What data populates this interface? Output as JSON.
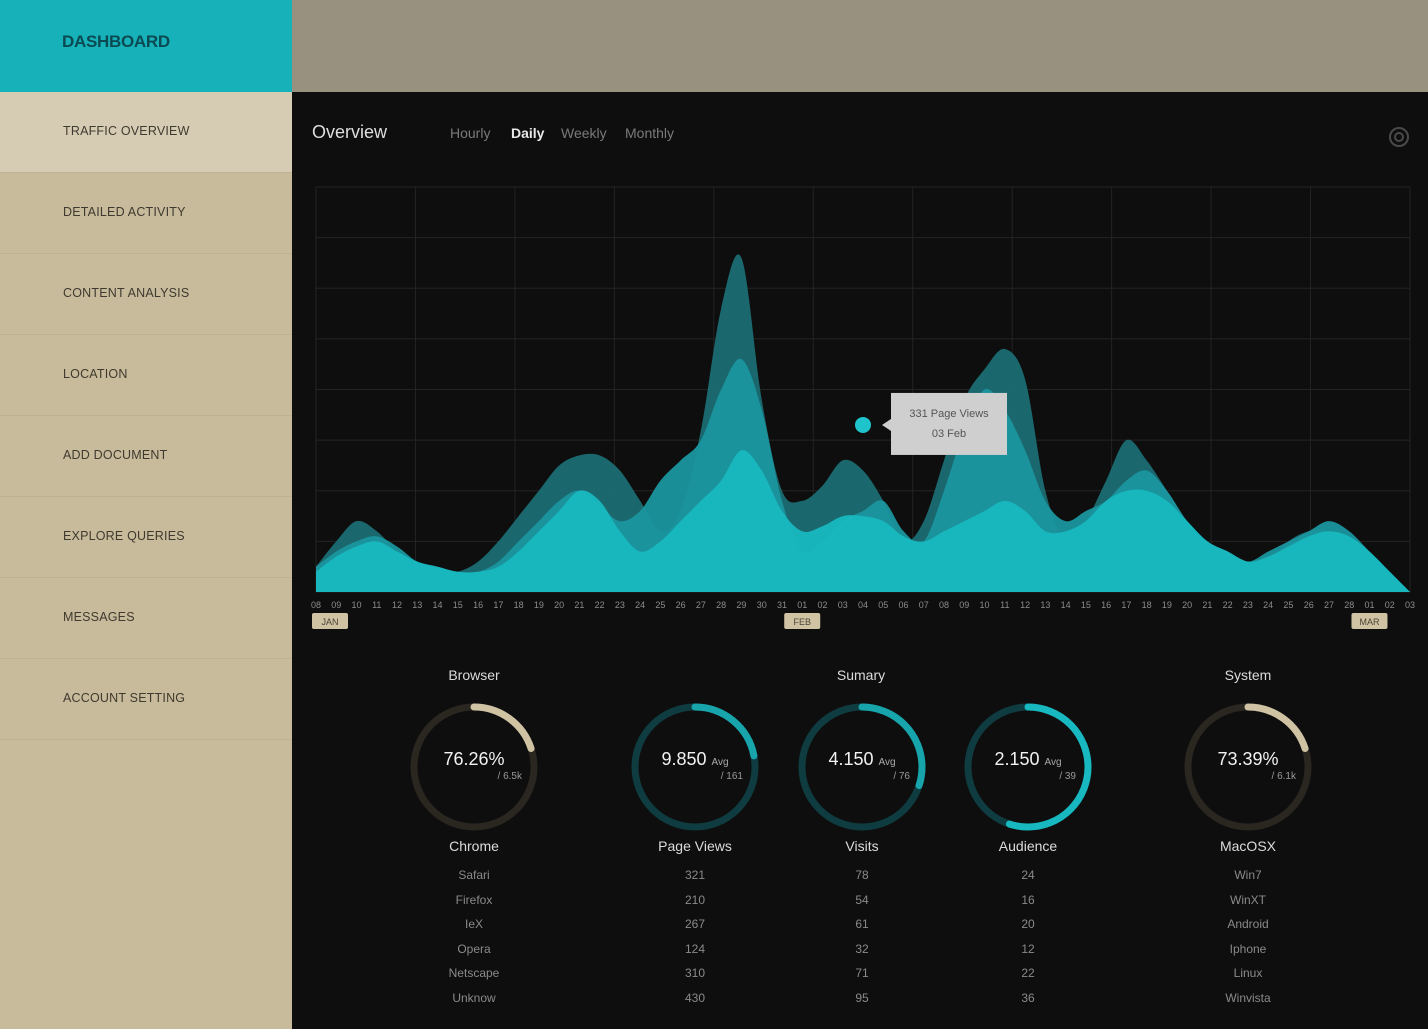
{
  "sidebar": {
    "brand": "DASHBOARD",
    "items": [
      {
        "label": "TRAFFIC OVERVIEW",
        "active": true
      },
      {
        "label": "DETAILED ACTIVITY"
      },
      {
        "label": "CONTENT ANALYSIS"
      },
      {
        "label": "LOCATION"
      },
      {
        "label": "ADD DOCUMENT"
      },
      {
        "label": "EXPLORE QUERIES"
      },
      {
        "label": "MESSAGES"
      },
      {
        "label": "ACCOUNT SETTING"
      }
    ]
  },
  "overview": {
    "title": "Overview",
    "tabs": [
      "Hourly",
      "Daily",
      "Weekly",
      "Monthly"
    ],
    "active_tab": "Daily",
    "settings_icon": "gear-icon"
  },
  "chart_data": {
    "type": "area",
    "x": [
      "08",
      "09",
      "10",
      "11",
      "12",
      "13",
      "14",
      "15",
      "16",
      "17",
      "18",
      "19",
      "20",
      "21",
      "22",
      "23",
      "24",
      "25",
      "26",
      "27",
      "28",
      "29",
      "30",
      "31",
      "01",
      "02",
      "03",
      "04",
      "05",
      "06",
      "07",
      "08",
      "09",
      "10",
      "11",
      "12",
      "13",
      "14",
      "15",
      "16",
      "17",
      "18",
      "19",
      "20",
      "21",
      "22",
      "23",
      "24",
      "25",
      "26",
      "27",
      "28",
      "01",
      "02",
      "03"
    ],
    "months": [
      {
        "label": "JAN",
        "at": 0
      },
      {
        "label": "FEB",
        "at": 24
      },
      {
        "label": "MAR",
        "at": 52
      }
    ],
    "series": [
      {
        "color": "#1b6e74",
        "values": [
          5,
          10,
          14,
          12,
          8,
          5,
          4,
          4,
          6,
          10,
          15,
          20,
          25,
          27,
          27,
          24,
          18,
          12,
          16,
          32,
          56,
          66,
          38,
          20,
          18,
          21,
          26,
          24,
          18,
          10,
          14,
          26,
          38,
          44,
          48,
          42,
          20,
          10,
          14,
          22,
          30,
          26,
          20,
          14,
          10,
          8,
          6,
          6,
          10,
          12,
          12,
          10,
          6,
          3,
          0
        ]
      },
      {
        "color": "#1a969e",
        "values": [
          5,
          8,
          10,
          11,
          9,
          6,
          5,
          4,
          4,
          6,
          10,
          14,
          18,
          20,
          17,
          14,
          16,
          22,
          26,
          30,
          40,
          46,
          36,
          18,
          8,
          10,
          14,
          16,
          18,
          12,
          10,
          20,
          32,
          40,
          36,
          28,
          18,
          14,
          16,
          18,
          22,
          24,
          20,
          14,
          10,
          8,
          6,
          8,
          10,
          12,
          14,
          12,
          8,
          4,
          0
        ]
      },
      {
        "color": "#18b8bf",
        "values": [
          4,
          7,
          9,
          10,
          8,
          6,
          5,
          4,
          4,
          5,
          8,
          12,
          16,
          20,
          18,
          12,
          8,
          10,
          14,
          18,
          22,
          28,
          24,
          16,
          12,
          13,
          15,
          15,
          14,
          11,
          10,
          12,
          14,
          16,
          18,
          16,
          12,
          12,
          14,
          18,
          20,
          20,
          18,
          14,
          10,
          8,
          6,
          7,
          9,
          11,
          12,
          11,
          8,
          4,
          0
        ]
      }
    ],
    "marker": {
      "x_index": 27,
      "value": 33
    },
    "tooltip": {
      "line1": "331 Page Views",
      "line2": "03 Feb"
    },
    "ylim": [
      0,
      80
    ],
    "grid": true
  },
  "stats": {
    "browser": {
      "title": "Browser",
      "ring_value": "76.26%",
      "ring_sub": "/ 6.5k",
      "ring_fraction": 0.2,
      "ring_color": "#cfc3a4",
      "label": "Chrome",
      "items": [
        "Safari",
        "Firefox",
        "IeX",
        "Opera",
        "Netscape",
        "Unknow"
      ]
    },
    "summary": {
      "title": "Sumary",
      "rings": [
        {
          "value": "9.850",
          "avg": "Avg",
          "sub": "/ 161",
          "fraction": 0.22,
          "color": "#17a4ab",
          "label": "Page Views",
          "items": [
            "321",
            "210",
            "267",
            "124",
            "310",
            "430"
          ]
        },
        {
          "value": "4.150",
          "avg": "Avg",
          "sub": "/ 76",
          "fraction": 0.3,
          "color": "#17a4ab",
          "label": "Visits",
          "items": [
            "78",
            "54",
            "61",
            "32",
            "71",
            "95"
          ]
        },
        {
          "value": "2.150",
          "avg": "Avg",
          "sub": "/ 39",
          "fraction": 0.55,
          "color": "#17b8c0",
          "label": "Audience",
          "items": [
            "24",
            "16",
            "20",
            "12",
            "22",
            "36"
          ]
        }
      ]
    },
    "system": {
      "title": "System",
      "ring_value": "73.39%",
      "ring_sub": "/ 6.1k",
      "ring_fraction": 0.2,
      "ring_color": "#cfc3a4",
      "label": "MacOSX",
      "items": [
        "Win7",
        "WinXT",
        "Android",
        "Iphone",
        "Linux",
        "Winvista"
      ]
    }
  }
}
